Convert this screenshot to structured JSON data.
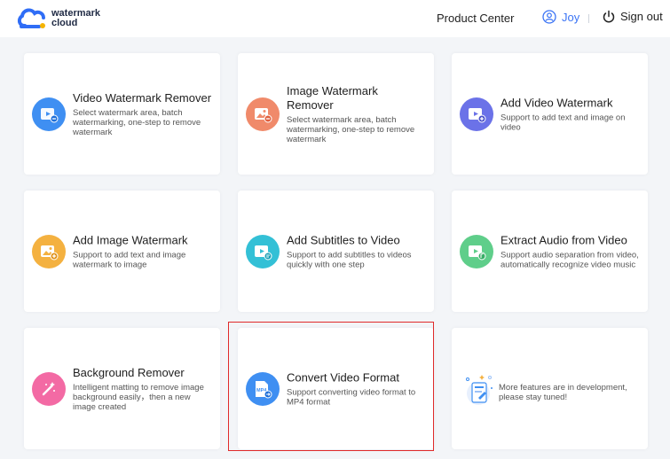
{
  "header": {
    "logo_line1": "watermark",
    "logo_line2": "cloud",
    "product_center": "Product Center",
    "user_name": "Joy",
    "sign_out": "Sign out"
  },
  "colors": {
    "accent": "#3b74f5",
    "selected_border": "#e02a2a"
  },
  "cards": [
    {
      "title": "Video Watermark Remover",
      "desc": "Select watermark area, batch watermarking, one-step to remove watermark",
      "icon": "video-watermark-remove-icon"
    },
    {
      "title": "Image Watermark Remover",
      "desc": "Select watermark area, batch watermarking, one-step to remove watermark",
      "icon": "image-watermark-remove-icon"
    },
    {
      "title": "Add Video Watermark",
      "desc": "Support to add text and image on video",
      "icon": "video-watermark-add-icon"
    },
    {
      "title": "Add Image Watermark",
      "desc": "Support to add text and image watermark to image",
      "icon": "image-watermark-add-icon"
    },
    {
      "title": "Add Subtitles to Video",
      "desc": "Support to add subtitles to videos quickly with one step",
      "icon": "subtitle-icon"
    },
    {
      "title": "Extract Audio from Video",
      "desc": "Support audio separation from video, automatically recognize video music",
      "icon": "audio-extract-icon"
    },
    {
      "title": "Background Remover",
      "desc": "Intelligent matting to remove image background easily，then a new image created",
      "icon": "magic-wand-icon"
    },
    {
      "title": "Convert Video Format",
      "desc": "Support converting video format to MP4 format",
      "icon": "mp4-file-icon",
      "icon_label": "MP4"
    },
    {
      "desc": "More features are in development, please stay tuned!",
      "icon": "development-illustration-icon"
    }
  ]
}
